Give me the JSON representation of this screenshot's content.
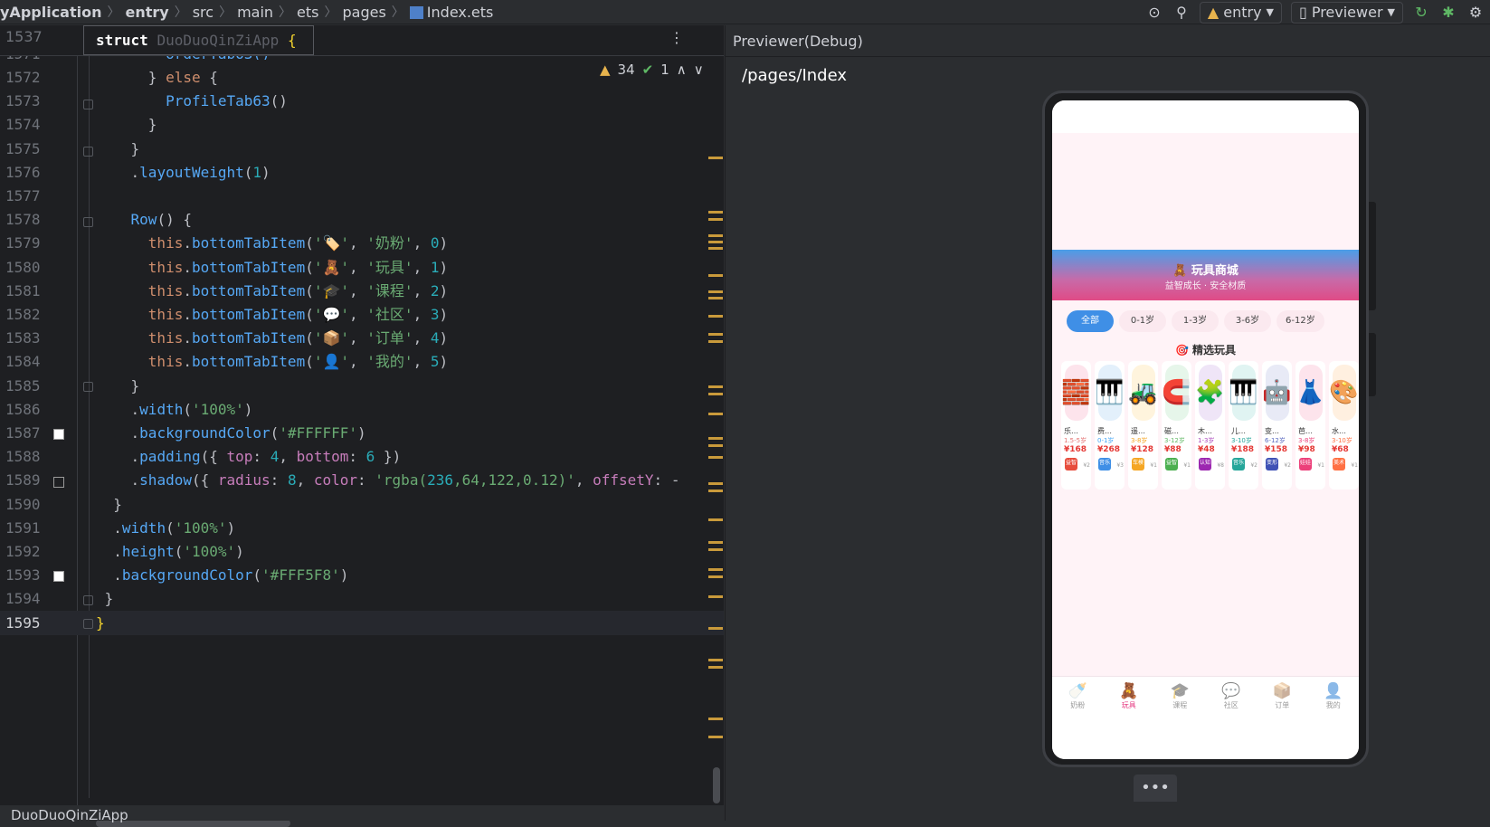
{
  "breadcrumbs": [
    "yApplication",
    "entry",
    "src",
    "main",
    "ets",
    "pages",
    "Index.ets"
  ],
  "toolbar": {
    "module": "entry",
    "device": "Previewer"
  },
  "editor": {
    "sticky": {
      "ln": "1537",
      "kw": "struct",
      "name": "DuoDuoQinZiApp",
      "brace": "{"
    },
    "partial_ln": "1571",
    "partial_code": "        orderTab63()",
    "warnings": "34",
    "checks": "1",
    "lines": [
      {
        "ln": "1572",
        "code": "      } else {"
      },
      {
        "ln": "1573",
        "code": "        ProfileTab63()"
      },
      {
        "ln": "1574",
        "code": "      }"
      },
      {
        "ln": "1575",
        "code": "    }"
      },
      {
        "ln": "1576",
        "code": "    .layoutWeight(1)"
      },
      {
        "ln": "1577",
        "code": ""
      },
      {
        "ln": "1578",
        "code": "    Row() {"
      },
      {
        "ln": "1579",
        "code": "      this.bottomTabItem('🏷️', '奶粉', 0)"
      },
      {
        "ln": "1580",
        "code": "      this.bottomTabItem('🧸', '玩具', 1)"
      },
      {
        "ln": "1581",
        "code": "      this.bottomTabItem('🎓', '课程', 2)"
      },
      {
        "ln": "1582",
        "code": "      this.bottomTabItem('💬', '社区', 3)"
      },
      {
        "ln": "1583",
        "code": "      this.bottomTabItem('📦', '订单', 4)"
      },
      {
        "ln": "1584",
        "code": "      this.bottomTabItem('👤', '我的', 5)"
      },
      {
        "ln": "1585",
        "code": "    }"
      },
      {
        "ln": "1586",
        "code": "    .width('100%')"
      },
      {
        "ln": "1587",
        "code": "    .backgroundColor('#FFFFFF')"
      },
      {
        "ln": "1588",
        "code": "    .padding({ top: 4, bottom: 6 })"
      },
      {
        "ln": "1589",
        "code": "    .shadow({ radius: 8, color: 'rgba(236,64,122,0.12)', offsetY: -"
      },
      {
        "ln": "1590",
        "code": "  }"
      },
      {
        "ln": "1591",
        "code": "  .width('100%')"
      },
      {
        "ln": "1592",
        "code": "  .height('100%')"
      },
      {
        "ln": "1593",
        "code": "  .backgroundColor('#FFF5F8')"
      },
      {
        "ln": "1594",
        "code": " }"
      },
      {
        "ln": "1595",
        "code": "}"
      }
    ],
    "status_text": "DuoDuoQinZiApp"
  },
  "previewer": {
    "title": "Previewer(Debug)",
    "path": "/pages/Index",
    "app": {
      "banner_title": "🧸 玩具商城",
      "banner_sub": "益智成长 · 安全材质",
      "chips": [
        "全部",
        "0-1岁",
        "1-3岁",
        "3-6岁",
        "6-12岁"
      ],
      "section_title": "🎯 精选玩具",
      "cards": [
        {
          "icon": "🧱",
          "name": "乐…",
          "age": "1.5-5岁",
          "price": "¥168",
          "old": "¥2",
          "tag": "益智",
          "bg": "#fde4ec",
          "tagc": "#e74c3c",
          "agec": "#e57373"
        },
        {
          "icon": "🎹",
          "name": "费…",
          "age": "0-1岁",
          "price": "¥268",
          "old": "¥3",
          "tag": "音乐",
          "bg": "#e3f0fb",
          "tagc": "#3f8fe6",
          "agec": "#42a5f5"
        },
        {
          "icon": "🚜",
          "name": "遥…",
          "age": "3-8岁",
          "price": "¥128",
          "old": "¥1",
          "tag": "车模",
          "bg": "#fff4dd",
          "tagc": "#f5a623",
          "agec": "#f5a623"
        },
        {
          "icon": "🧲",
          "name": "磁…",
          "age": "3-12岁",
          "price": "¥88",
          "old": "¥1",
          "tag": "益智",
          "bg": "#e6f6ea",
          "tagc": "#4caf50",
          "agec": "#66bb6a"
        },
        {
          "icon": "🧩",
          "name": "木…",
          "age": "1-3岁",
          "price": "¥48",
          "old": "¥8",
          "tag": "认知",
          "bg": "#efe5f7",
          "tagc": "#9c27b0",
          "agec": "#ab47bc"
        },
        {
          "icon": "🎹",
          "name": "儿…",
          "age": "3-10岁",
          "price": "¥188",
          "old": "¥2",
          "tag": "音乐",
          "bg": "#e0f4f2",
          "tagc": "#26a69a",
          "agec": "#26a69a"
        },
        {
          "icon": "🤖",
          "name": "变…",
          "age": "6-12岁",
          "price": "¥158",
          "old": "¥2",
          "tag": "变形",
          "bg": "#e8eaf6",
          "tagc": "#3f51b5",
          "agec": "#5c6bc0"
        },
        {
          "icon": "👗",
          "name": "芭…",
          "age": "3-8岁",
          "price": "¥98",
          "old": "¥1",
          "tag": "娃娃",
          "bg": "#fde4ec",
          "tagc": "#ec407a",
          "agec": "#ec407a"
        },
        {
          "icon": "🎨",
          "name": "水…",
          "age": "3-10岁",
          "price": "¥68",
          "old": "¥1",
          "tag": "美术",
          "bg": "#fff0e0",
          "tagc": "#ff7043",
          "agec": "#ff7043"
        }
      ],
      "tabs": [
        {
          "icon": "🍼",
          "label": "奶粉"
        },
        {
          "icon": "🧸",
          "label": "玩具"
        },
        {
          "icon": "🎓",
          "label": "课程"
        },
        {
          "icon": "💬",
          "label": "社区"
        },
        {
          "icon": "📦",
          "label": "订单"
        },
        {
          "icon": "👤",
          "label": "我的"
        }
      ],
      "active_tab": 1
    }
  },
  "more_label": "•••"
}
